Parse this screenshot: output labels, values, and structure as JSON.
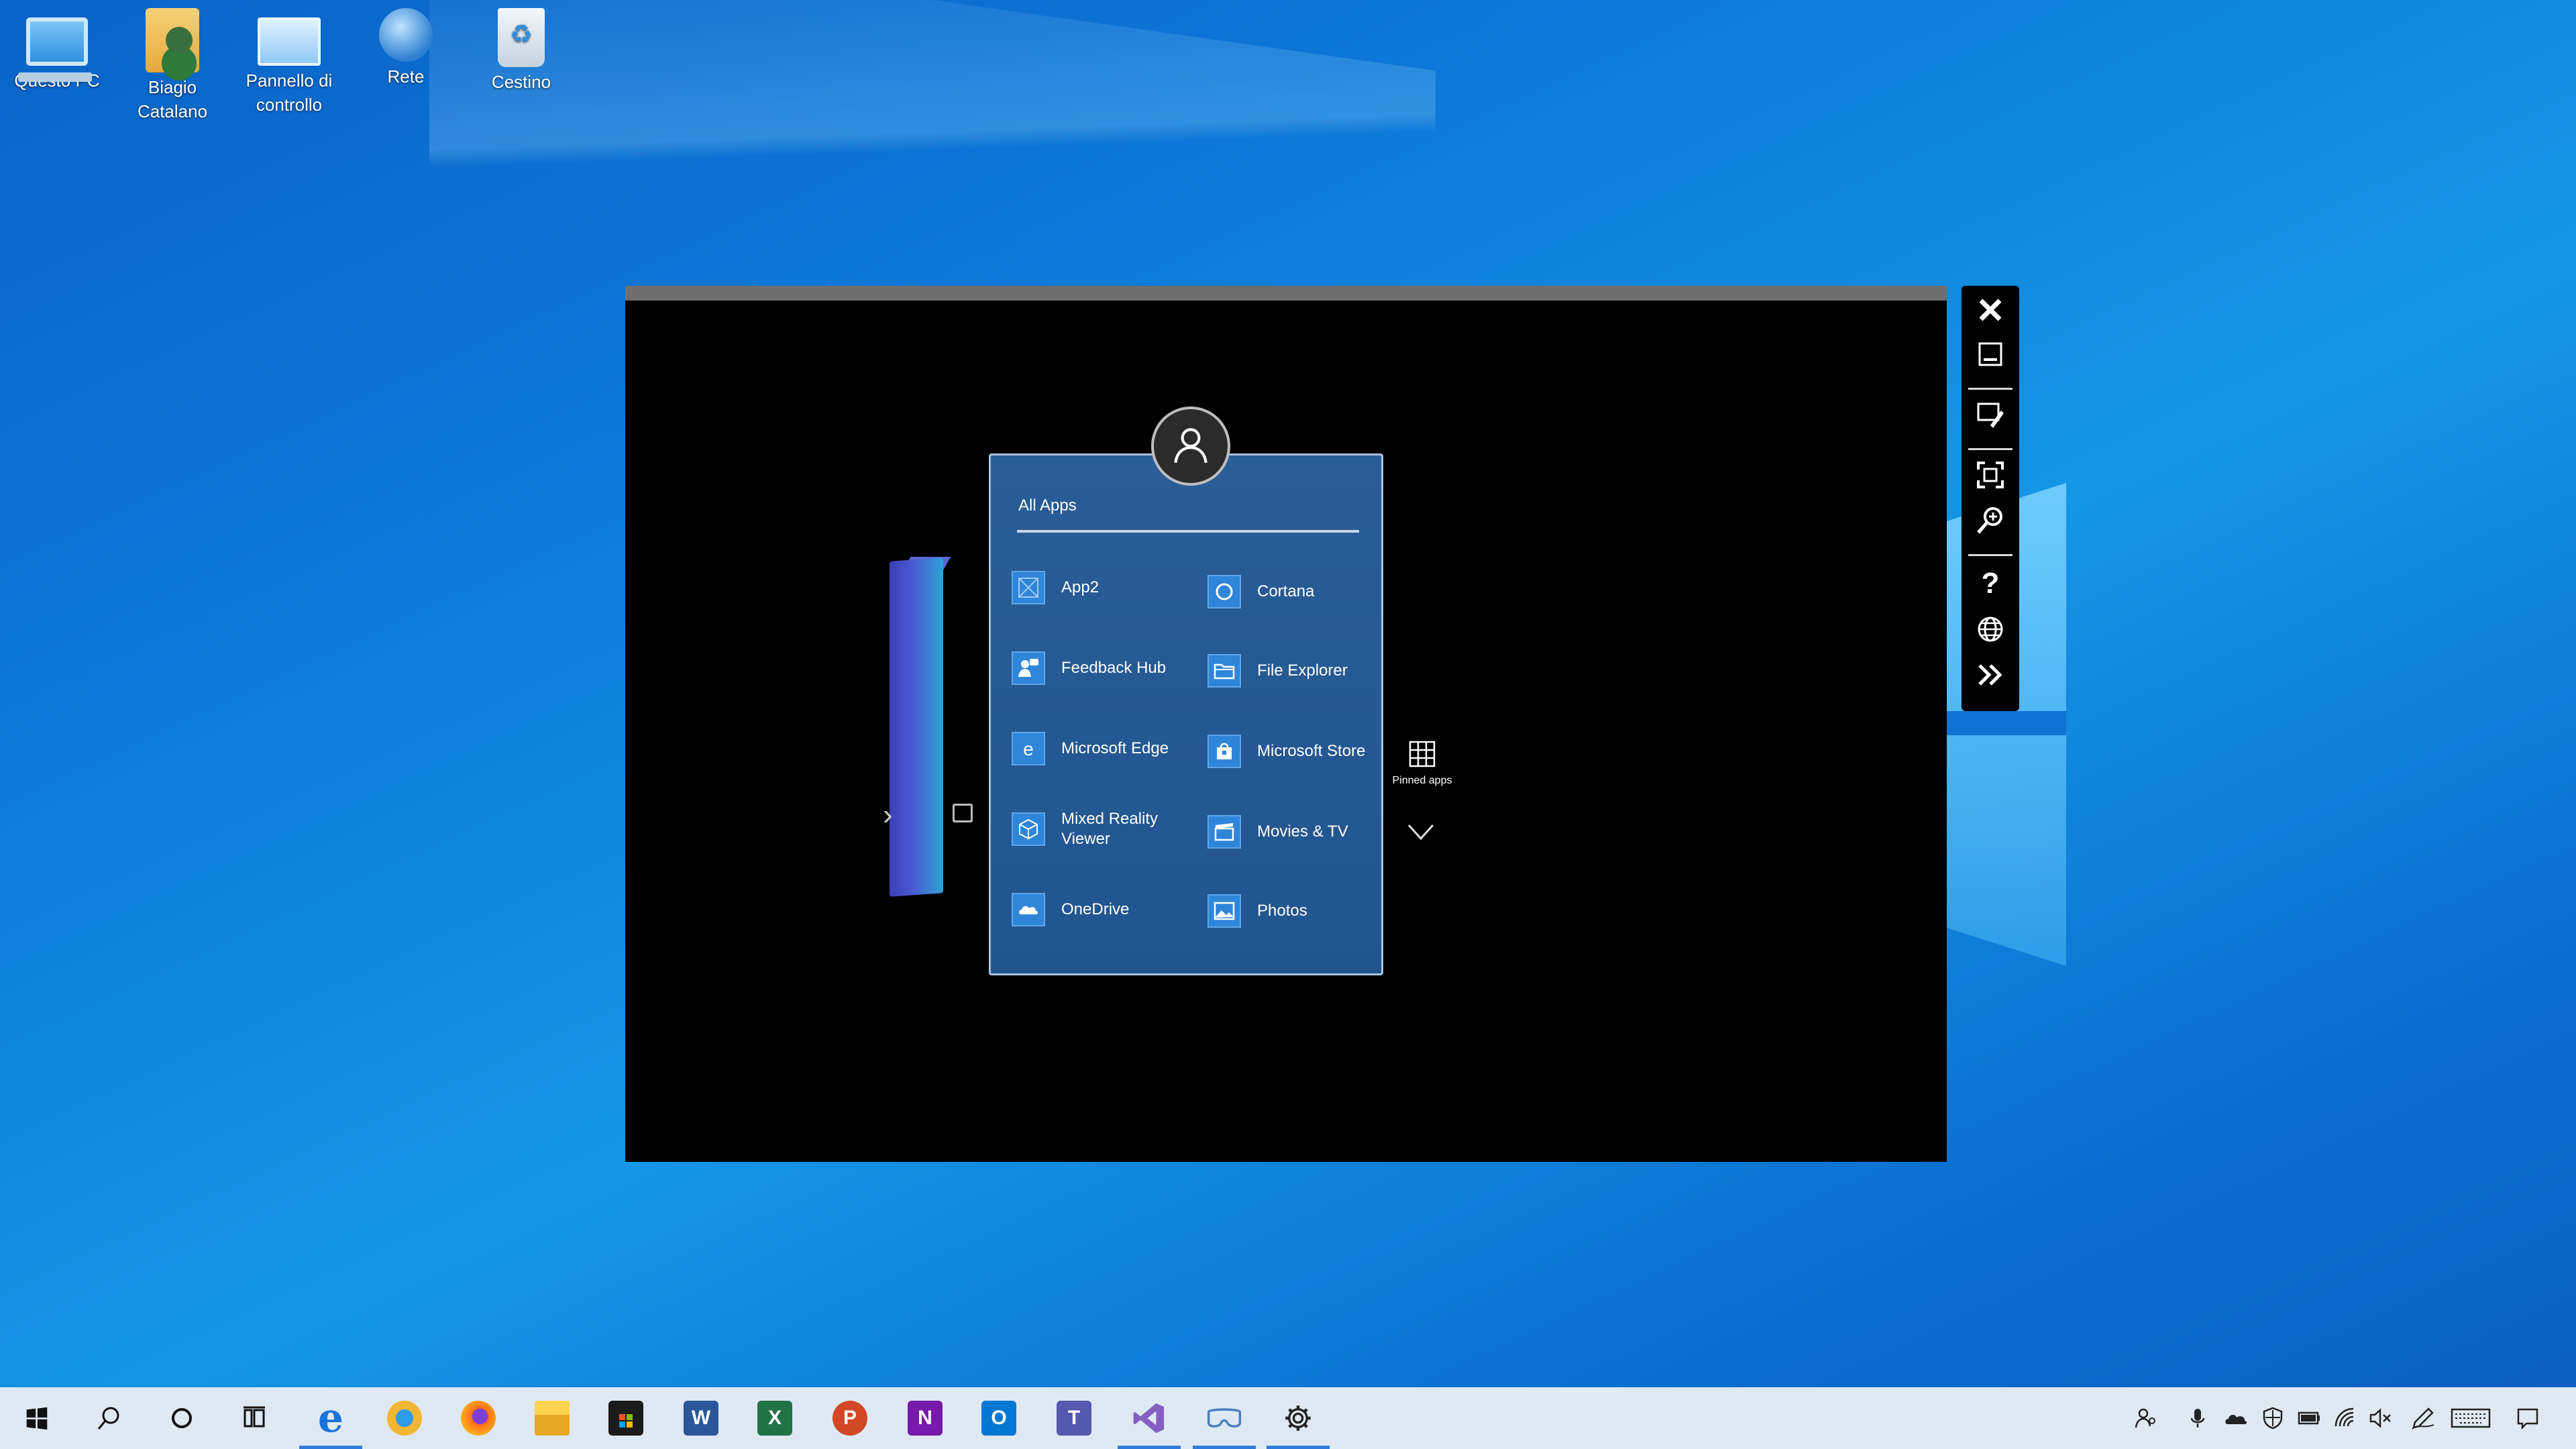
{
  "desktop": {
    "icons": [
      {
        "label_1": "Questo PC",
        "label_2": ""
      },
      {
        "label_1": "Biagio",
        "label_2": "Catalano"
      },
      {
        "label_1": "Pannello di",
        "label_2": "controllo"
      },
      {
        "label_1": "Rete",
        "label_2": ""
      },
      {
        "label_1": "Cestino",
        "label_2": ""
      }
    ]
  },
  "start_panel": {
    "title": "All Apps",
    "apps": [
      {
        "label": "App2",
        "icon": "app-placeholder-icon"
      },
      {
        "label": "Cortana",
        "icon": "cortana-icon"
      },
      {
        "label": "Feedback Hub",
        "icon": "feedback-hub-icon"
      },
      {
        "label": "File Explorer",
        "icon": "file-explorer-icon"
      },
      {
        "label": "Microsoft Edge",
        "icon": "edge-icon"
      },
      {
        "label": "Microsoft Store",
        "icon": "store-icon"
      },
      {
        "label": "Mixed Reality",
        "label_2": "Viewer",
        "icon": "mixed-reality-viewer-icon"
      },
      {
        "label": "Movies & TV",
        "icon": "movies-tv-icon"
      },
      {
        "label": "OneDrive",
        "icon": "onedrive-icon"
      },
      {
        "label": "Photos",
        "icon": "photos-icon"
      }
    ],
    "pinned_label": "Pinned apps"
  },
  "toolstrip": {
    "tools": [
      "close-icon",
      "minimize-icon",
      "interact-icon",
      "fit-screen-icon",
      "zoom-icon",
      "help-icon",
      "network-icon",
      "more-icon"
    ]
  },
  "taskbar": {
    "apps": [
      "windows-start-icon",
      "search-icon",
      "cortana-icon",
      "task-view-icon",
      "edge-icon",
      "edge-beta-icon",
      "firefox-icon",
      "file-explorer-icon",
      "store-icon",
      "word-icon",
      "excel-icon",
      "powerpoint-icon",
      "onenote-icon",
      "outlook-icon",
      "teams-icon",
      "visual-studio-icon",
      "mixed-reality-portal-icon",
      "settings-icon"
    ],
    "letters": {
      "word": "W",
      "excel": "X",
      "powerpoint": "P",
      "onenote": "N",
      "outlook": "O",
      "teams": "T"
    },
    "tray": [
      "people-icon",
      "microphone-icon",
      "onedrive-icon",
      "security-icon",
      "battery-icon",
      "wifi-icon",
      "volume-muted-icon",
      "pen-icon",
      "keyboard-icon",
      "notifications-icon"
    ]
  },
  "colors": {
    "desktop_accent": "#0d7ad8",
    "panel": "#2a5d96",
    "taskbar": "#dfe9f3",
    "active_indicator": "#2f7bd8"
  }
}
